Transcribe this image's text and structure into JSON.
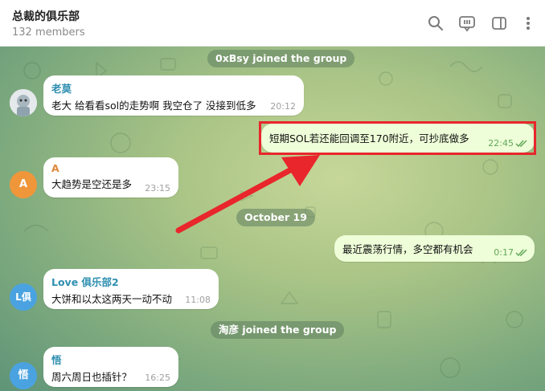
{
  "header": {
    "title": "总裁的俱乐部",
    "subtitle": "132 members",
    "icons": [
      "search-icon",
      "chat-topics-icon",
      "sidebar-toggle-icon",
      "more-vertical-icon"
    ]
  },
  "services": {
    "joined1": "0xBsy joined the group",
    "date": "October 19",
    "joined2": "淘彦 joined the group"
  },
  "messages": {
    "m1": {
      "name": "老莫",
      "text": "老大 给看看sol的走势啊 我空仓了 没接到低多",
      "time": "20:12",
      "name_color": "#2f8fb0"
    },
    "m2": {
      "text": "短期SOL若还能回调至170附近，可抄底做多",
      "time": "22:45"
    },
    "m3": {
      "name": "A",
      "avatar_text": "A",
      "text": "大趋势是空还是多",
      "time": "23:15",
      "name_color": "#e0873a"
    },
    "m4": {
      "text": "最近震荡行情，多空都有机会",
      "time": "0:17"
    },
    "m5": {
      "name": "Love 俱乐部2",
      "avatar_text": "L俱",
      "text": "大饼和以太这两天一动不动",
      "time": "11:08",
      "name_color": "#2f8fb0"
    },
    "m6": {
      "name": "悟",
      "avatar_text": "悟",
      "text": "周六周日也插针？",
      "time": "16:25",
      "name_color": "#2f8fb0"
    }
  },
  "colors": {
    "highlight": "#e8262b",
    "outgoing_bubble": "#eefed8",
    "avatar_orange": "#f0963a",
    "avatar_blue": "#4aa3e0"
  }
}
